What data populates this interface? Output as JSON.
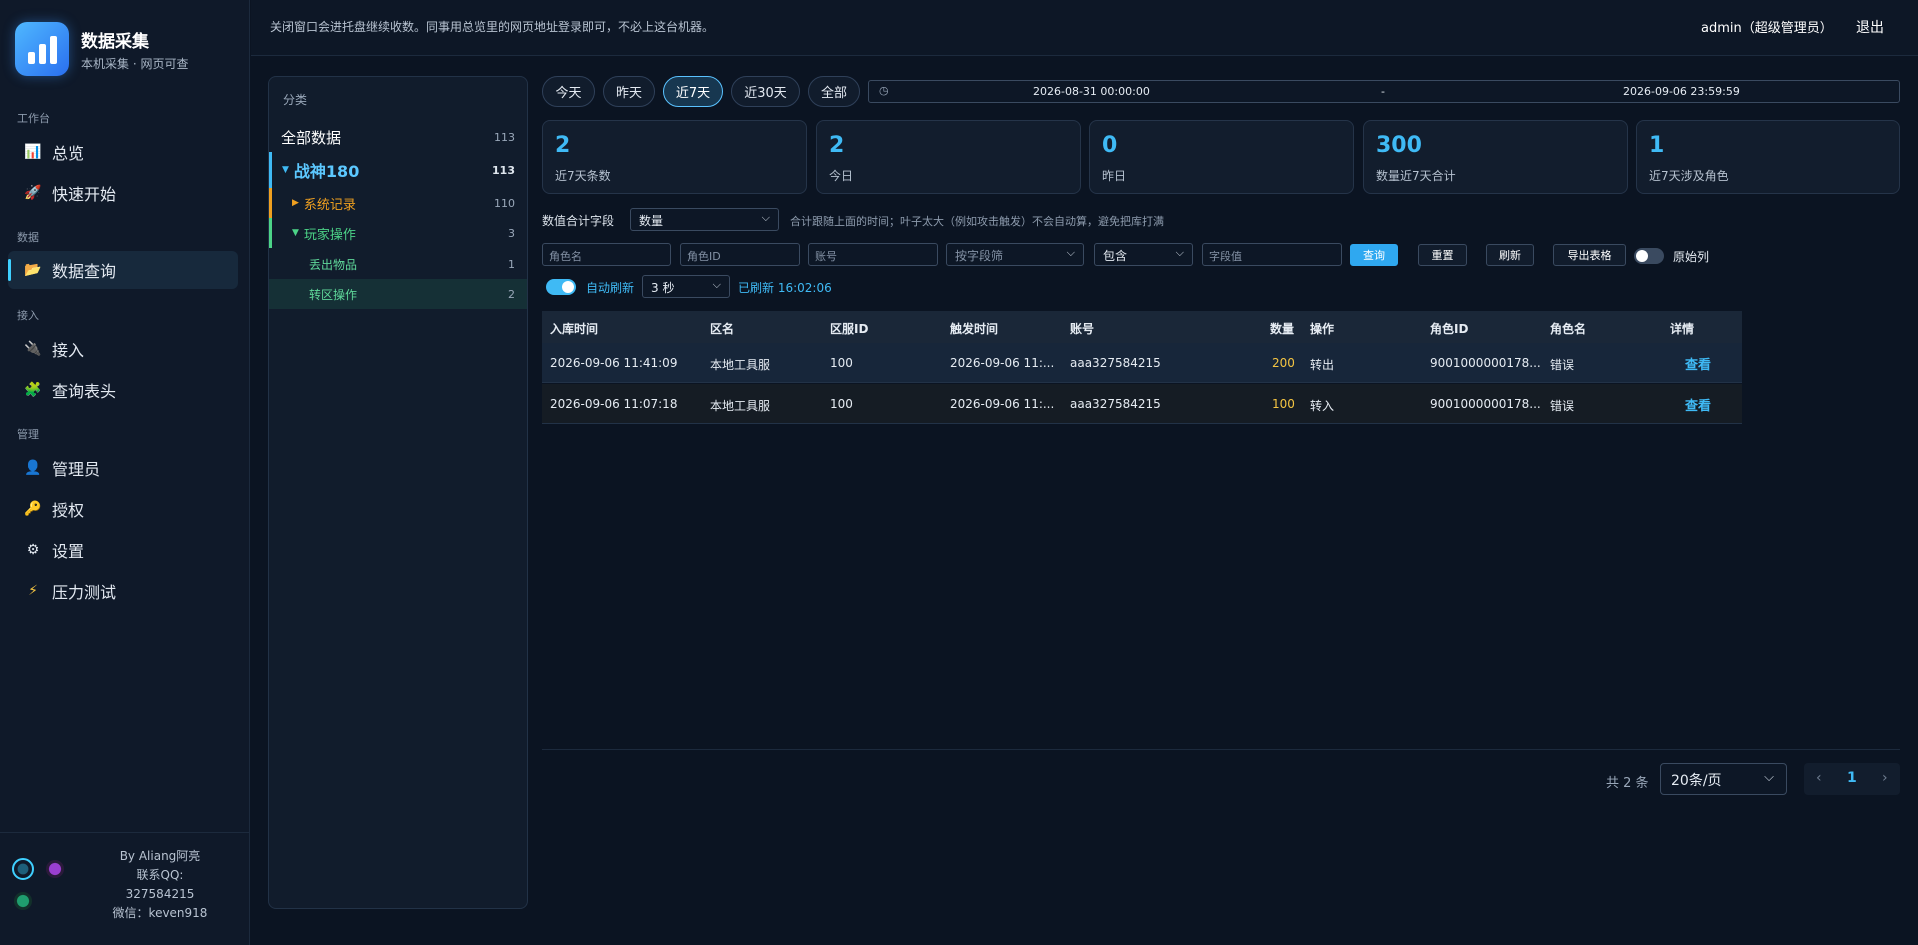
{
  "brand": {
    "title": "数据采集",
    "subtitle": "本机采集 · 网页可查"
  },
  "nav": {
    "groups": [
      "工作台",
      "数据",
      "接入",
      "管理"
    ],
    "items": [
      {
        "label": "总览",
        "icon": "bar-chart-icon"
      },
      {
        "label": "快速开始",
        "icon": "rocket-icon"
      },
      {
        "label": "数据查询",
        "icon": "folder-icon"
      },
      {
        "label": "接入",
        "icon": "plug-icon"
      },
      {
        "label": "查询表头",
        "icon": "puzzle-icon"
      },
      {
        "label": "管理员",
        "icon": "user-icon"
      },
      {
        "label": "授权",
        "icon": "key-icon"
      },
      {
        "label": "设置",
        "icon": "gear-icon"
      },
      {
        "label": "压力测试",
        "icon": "lightning-icon"
      }
    ]
  },
  "footer": {
    "by": "By Aliang阿亮",
    "qq_label": "联系QQ:",
    "qq": "327584215",
    "wechat": "微信：keven918"
  },
  "topbar": {
    "notice": "关闭窗口会进托盘继续收数。同事用总览里的网页地址登录即可，不必上这台机器。",
    "user": "admin（超级管理员）",
    "logout": "退出"
  },
  "categories": {
    "header": "分类",
    "all": {
      "label": "全部数据",
      "count": "113"
    },
    "server": {
      "label": "战神180",
      "count": "113"
    },
    "system": {
      "label": "系统记录",
      "count": "110"
    },
    "player": {
      "label": "玩家操作",
      "count": "3"
    },
    "drop": {
      "label": "丢出物品",
      "count": "1"
    },
    "transfer": {
      "label": "转区操作",
      "count": "2"
    }
  },
  "time_filters": [
    "今天",
    "昨天",
    "近7天",
    "近30天",
    "全部"
  ],
  "date_range": {
    "start": "2026-08-31 00:00:00",
    "sep": "-",
    "end": "2026-09-06 23:59:59"
  },
  "stats": [
    {
      "value": "2",
      "label": "近7天条数"
    },
    {
      "value": "2",
      "label": "今日"
    },
    {
      "value": "0",
      "label": "昨日"
    },
    {
      "value": "300",
      "label": "数量近7天合计"
    },
    {
      "value": "1",
      "label": "近7天涉及角色"
    }
  ],
  "sum_field": {
    "label": "数值合计字段",
    "value": "数量",
    "hint": "合计跟随上面的时间；叶子太大（例如攻击触发）不会自动算，避免把库打满"
  },
  "filters": {
    "role_name": "角色名",
    "role_id": "角色ID",
    "account": "账号",
    "field_select": "按字段筛",
    "match": "包含",
    "field_value": "字段值",
    "query": "查询",
    "reset": "重置",
    "refresh": "刷新",
    "export": "导出表格",
    "raw_cols": "原始列",
    "auto_refresh": "自动刷新",
    "interval": "3 秒",
    "refreshed": "已刷新 16:02:06"
  },
  "table": {
    "headers": [
      "入库时间",
      "区名",
      "区服ID",
      "触发时间",
      "账号",
      "数量",
      "操作",
      "角色ID",
      "角色名",
      "详情"
    ],
    "rows": [
      [
        "2026-09-06 11:41:09",
        "本地工具服",
        "100",
        "2026-09-06 11:...",
        "aaa327584215",
        "200",
        "转出",
        "9001000000178...",
        "错误",
        "查看"
      ],
      [
        "2026-09-06 11:07:18",
        "本地工具服",
        "100",
        "2026-09-06 11:...",
        "aaa327584215",
        "100",
        "转入",
        "9001000000178...",
        "错误",
        "查看"
      ]
    ]
  },
  "pagination": {
    "total": "共 2 条",
    "page_size": "20条/页",
    "prev": "‹",
    "page": "1",
    "next": "›"
  },
  "colors": {
    "accent": "#3fbaf5",
    "active_nav": "#3fd0ff",
    "quantity": "#f5c542",
    "system": "#f0a020",
    "player": "#4cd488"
  }
}
